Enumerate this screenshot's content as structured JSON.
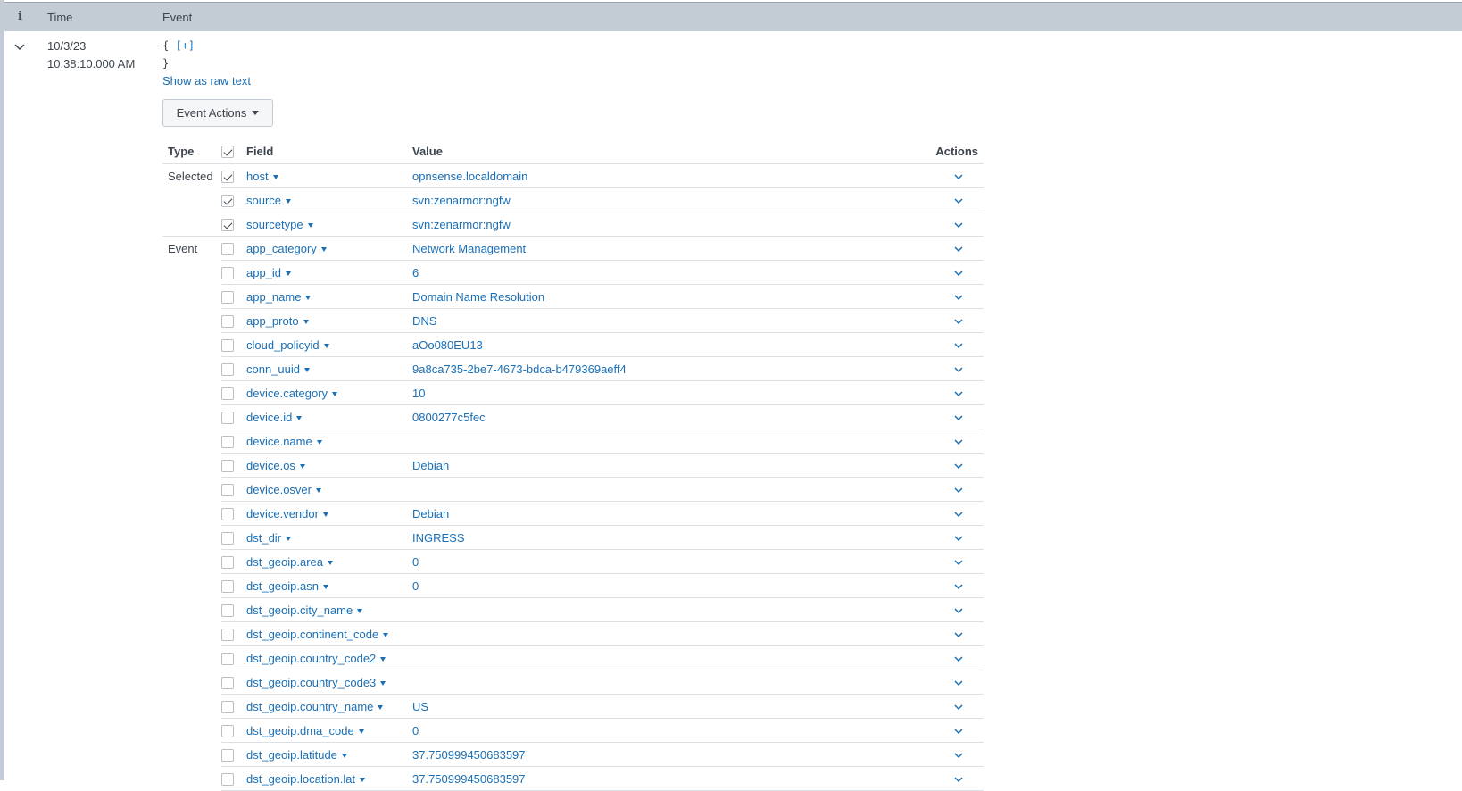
{
  "header": {
    "info_label": "i",
    "time_label": "Time",
    "event_label": "Event"
  },
  "event": {
    "date": "10/3/23",
    "time": "10:38:10.000 AM",
    "json_open": "{",
    "json_expand": "[+]",
    "json_close": "}",
    "show_raw_label": "Show as raw text",
    "event_actions_label": "Event Actions"
  },
  "table": {
    "headers": {
      "type": "Type",
      "field": "Field",
      "value": "Value",
      "actions": "Actions"
    },
    "rows": [
      {
        "type": "Selected",
        "field": "host",
        "value": "opnsense.localdomain",
        "checked": true
      },
      {
        "type": "",
        "field": "source",
        "value": "svn:zenarmor:ngfw",
        "checked": true
      },
      {
        "type": "",
        "field": "sourcetype",
        "value": "svn:zenarmor:ngfw",
        "checked": true,
        "group_end": true
      },
      {
        "type": "Event",
        "field": "app_category",
        "value": "Network Management",
        "checked": false
      },
      {
        "type": "",
        "field": "app_id",
        "value": "6",
        "checked": false
      },
      {
        "type": "",
        "field": "app_name",
        "value": "Domain Name Resolution",
        "checked": false
      },
      {
        "type": "",
        "field": "app_proto",
        "value": "DNS",
        "checked": false
      },
      {
        "type": "",
        "field": "cloud_policyid",
        "value": "aOo080EU13",
        "checked": false
      },
      {
        "type": "",
        "field": "conn_uuid",
        "value": "9a8ca735-2be7-4673-bdca-b479369aeff4",
        "checked": false
      },
      {
        "type": "",
        "field": "device.category",
        "value": "10",
        "checked": false
      },
      {
        "type": "",
        "field": "device.id",
        "value": "0800277c5fec",
        "checked": false
      },
      {
        "type": "",
        "field": "device.name",
        "value": "",
        "checked": false
      },
      {
        "type": "",
        "field": "device.os",
        "value": "Debian",
        "checked": false
      },
      {
        "type": "",
        "field": "device.osver",
        "value": "",
        "checked": false
      },
      {
        "type": "",
        "field": "device.vendor",
        "value": "Debian",
        "checked": false
      },
      {
        "type": "",
        "field": "dst_dir",
        "value": "INGRESS",
        "checked": false
      },
      {
        "type": "",
        "field": "dst_geoip.area",
        "value": "0",
        "checked": false
      },
      {
        "type": "",
        "field": "dst_geoip.asn",
        "value": "0",
        "checked": false
      },
      {
        "type": "",
        "field": "dst_geoip.city_name",
        "value": "",
        "checked": false
      },
      {
        "type": "",
        "field": "dst_geoip.continent_code",
        "value": "",
        "checked": false
      },
      {
        "type": "",
        "field": "dst_geoip.country_code2",
        "value": "",
        "checked": false
      },
      {
        "type": "",
        "field": "dst_geoip.country_code3",
        "value": "",
        "checked": false
      },
      {
        "type": "",
        "field": "dst_geoip.country_name",
        "value": "US",
        "checked": false
      },
      {
        "type": "",
        "field": "dst_geoip.dma_code",
        "value": "0",
        "checked": false
      },
      {
        "type": "",
        "field": "dst_geoip.latitude",
        "value": "37.750999450683597",
        "checked": false
      },
      {
        "type": "",
        "field": "dst_geoip.location.lat",
        "value": "37.750999450683597",
        "checked": false
      }
    ]
  },
  "colors": {
    "link": "#1a6fb5",
    "header_bg": "#c3cbd4",
    "text": "#3c444d",
    "row_border": "#dcdfe3"
  },
  "icons": {
    "expand": "chevron-down-icon",
    "row_action": "chevron-down-icon",
    "field_menu": "caret-down-icon"
  }
}
